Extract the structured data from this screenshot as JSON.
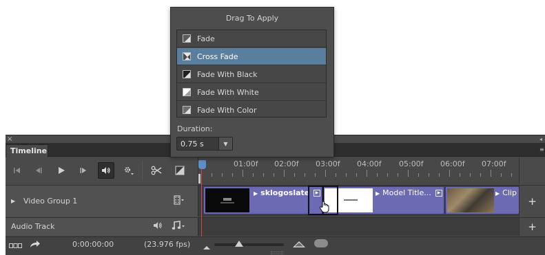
{
  "transitions_popup": {
    "title": "Drag To Apply",
    "items": [
      {
        "label": "Fade",
        "icon": "fade-icon",
        "selected": false
      },
      {
        "label": "Cross Fade",
        "icon": "cross-fade-icon",
        "selected": true
      },
      {
        "label": "Fade With Black",
        "icon": "fade-with-black-icon",
        "selected": false
      },
      {
        "label": "Fade With White",
        "icon": "fade-with-white-icon",
        "selected": false
      },
      {
        "label": "Fade With Color",
        "icon": "fade-with-color-icon",
        "selected": false
      }
    ],
    "duration_label": "Duration:",
    "duration_value": "0.75 s"
  },
  "panel": {
    "close_glyph": "×",
    "collapse_glyph": "◂",
    "menu_glyph": "≡",
    "tab_label": "Timeline"
  },
  "controls": {
    "icons": [
      "go-to-first-frame-icon",
      "previous-frame-icon",
      "play-icon",
      "next-frame-icon",
      "audio-icon",
      "settings-icon",
      "split-icon",
      "transition-icon"
    ]
  },
  "ruler": {
    "labels": [
      "01:00f",
      "02:00f",
      "03:00f",
      "04:00f",
      "05:00f",
      "06:00f",
      "07:00f"
    ]
  },
  "tracks": [
    {
      "name": "Video Group 1",
      "clips": [
        {
          "name": "sklogoslate"
        },
        {
          "name": "Model Title..."
        },
        {
          "name": "Clip"
        }
      ],
      "add_glyph": "+"
    },
    {
      "name": "Audio Track",
      "add_glyph": "+"
    }
  ],
  "bottom": {
    "timecode": "0:00:00:00",
    "fps": "(23.976 fps)"
  },
  "colors": {
    "clip": "#6d6ab4",
    "selected_transition": "#5a7f9e",
    "playhead": "#d9453a",
    "playhead_head": "#5d8fc8",
    "panel": "#4a4a4a"
  }
}
